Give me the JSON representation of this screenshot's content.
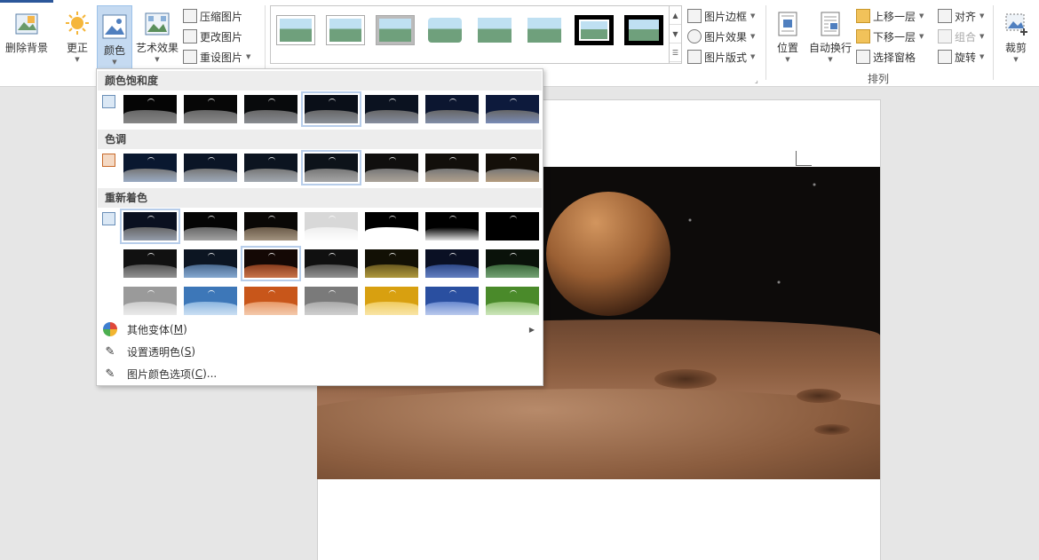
{
  "ribbon": {
    "remove_bg": "删除背景",
    "correct": "更正",
    "color": "颜色",
    "artistic": "艺术效果",
    "compress": "压缩图片",
    "change": "更改图片",
    "reset": "重设图片",
    "border": "图片边框",
    "effects": "图片效果",
    "layout": "图片版式",
    "position": "位置",
    "wrap": "自动换行",
    "bring_forward": "上移一层",
    "send_backward": "下移一层",
    "selection_pane": "选择窗格",
    "align": "对齐",
    "group": "组合",
    "rotate": "旋转",
    "arrange_group": "排列",
    "crop": "裁剪"
  },
  "color_menu": {
    "saturation_title": "颜色饱和度",
    "tone_title": "色调",
    "recolor_title": "重新着色",
    "more_variations": "其他变体",
    "more_variations_key": "M",
    "set_transparent": "设置透明色",
    "set_transparent_key": "S",
    "color_options": "图片颜色选项",
    "color_options_key": "C",
    "ellipsis": "..."
  },
  "theme": {
    "accent": "#2b579a",
    "selection": "#c5daf1",
    "highlight_border": "#b7cdea"
  }
}
